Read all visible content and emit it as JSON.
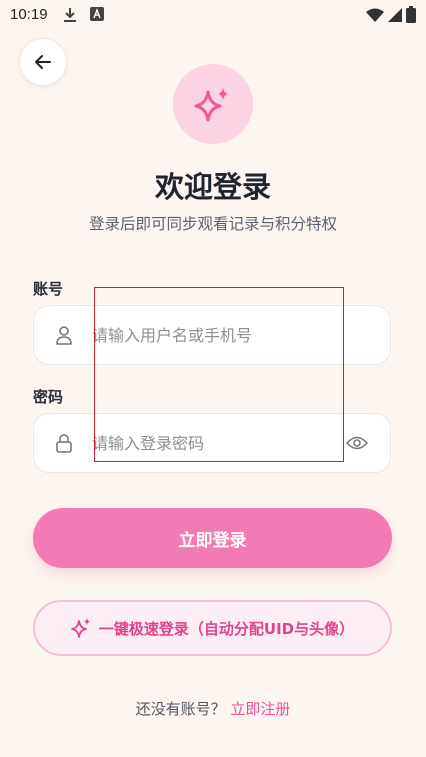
{
  "status_bar": {
    "time": "10:19"
  },
  "header": {
    "title": "欢迎登录",
    "subtitle": "登录后即可同步观看记录与积分特权"
  },
  "form": {
    "account_label": "账号",
    "account_placeholder": "请输入用户名或手机号",
    "password_label": "密码",
    "password_placeholder": "请输入登录密码"
  },
  "actions": {
    "login_label": "立即登录",
    "quick_login_label": "一键极速登录（自动分配UID与头像）"
  },
  "footer": {
    "prompt": "还没有账号？",
    "register_label": "立即注册"
  },
  "colors": {
    "accent": "#f27bb5",
    "quick_text": "#e0448e",
    "background": "#fdf6f0"
  }
}
